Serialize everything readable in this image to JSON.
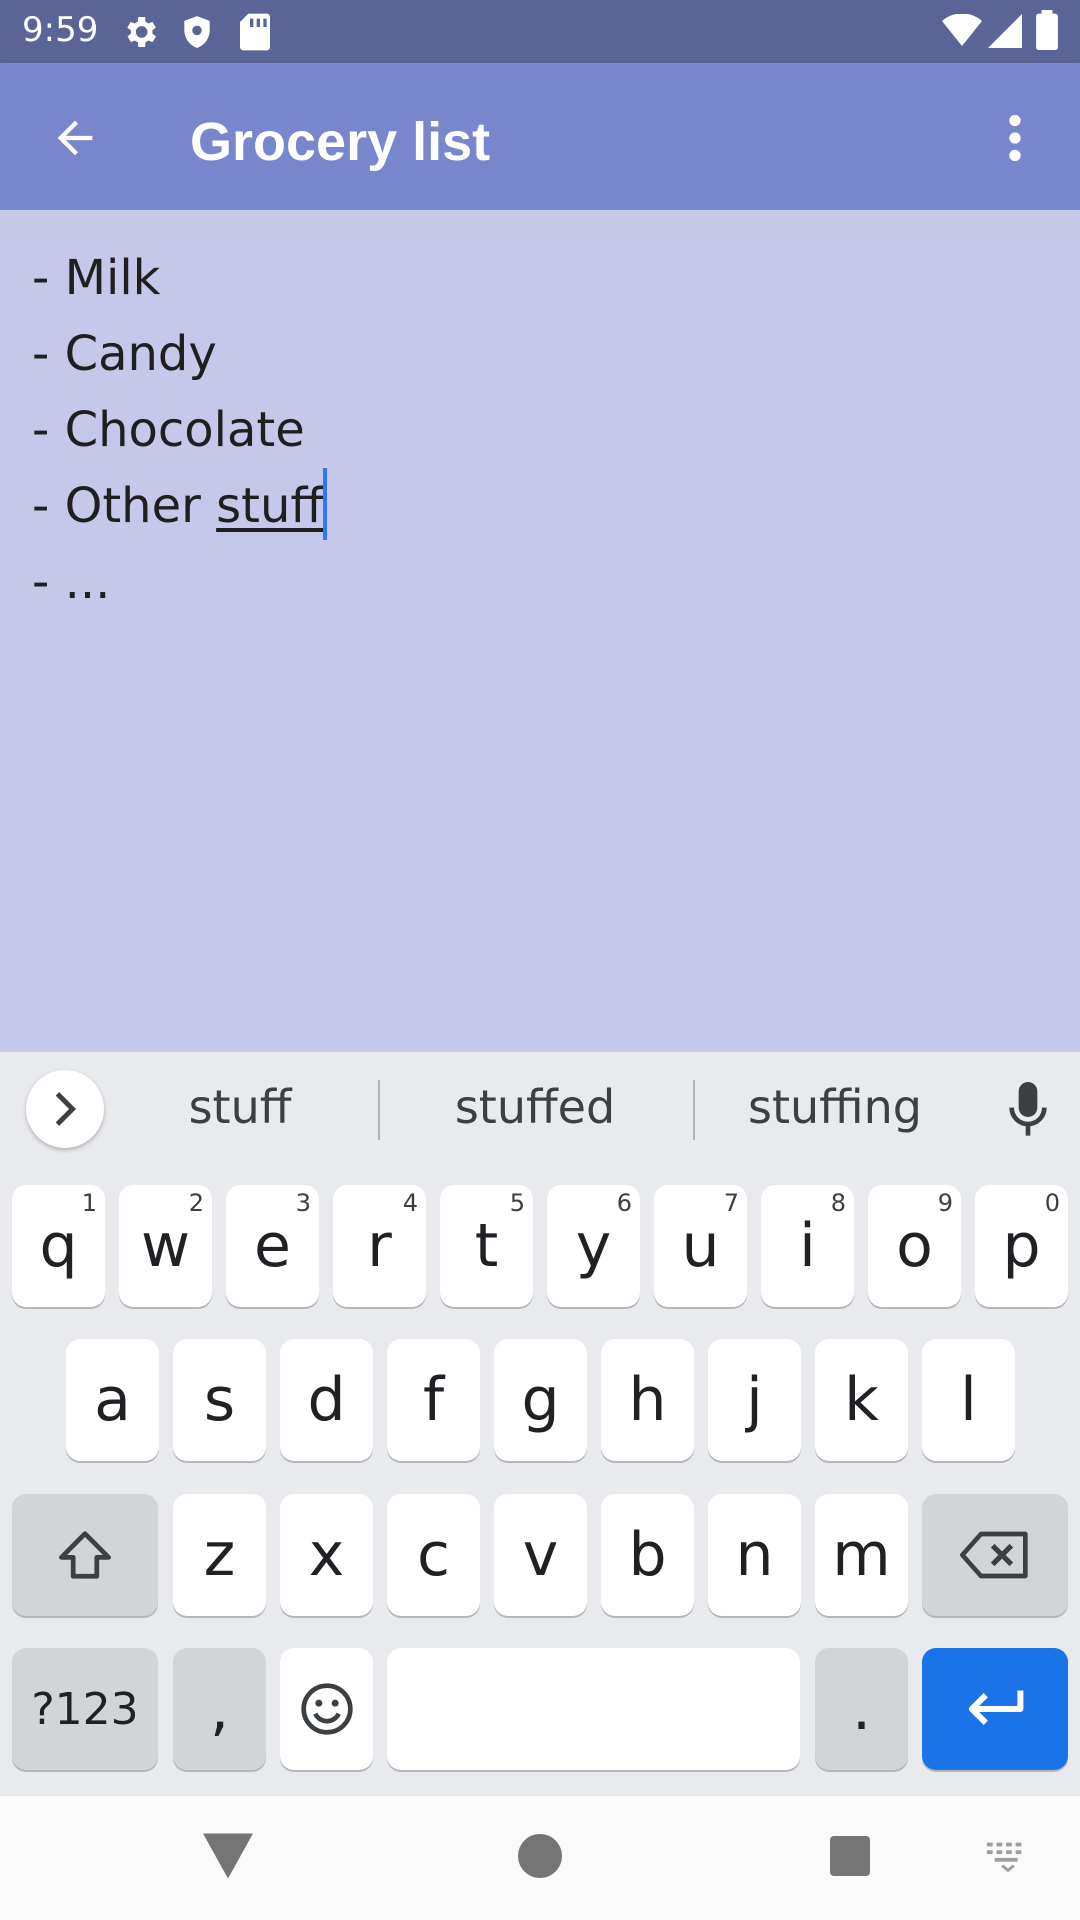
{
  "status_bar": {
    "time": "9:59",
    "icons_left": [
      "gear-icon",
      "shield-icon",
      "sd-card-icon"
    ],
    "icons_right": [
      "wifi-icon",
      "signal-icon",
      "battery-icon"
    ]
  },
  "app_bar": {
    "title": "Grocery list",
    "back_icon": "arrow-back-icon",
    "menu_icon": "more-vert-icon"
  },
  "note": {
    "lines": [
      "- Milk",
      "- Candy",
      "- Chocolate",
      "- Other ",
      "- ..."
    ],
    "composing_word": "stuff"
  },
  "keyboard": {
    "suggestions": [
      "stuff",
      "stuffed",
      "stuffing"
    ],
    "row1": [
      {
        "key": "q",
        "hint": "1"
      },
      {
        "key": "w",
        "hint": "2"
      },
      {
        "key": "e",
        "hint": "3"
      },
      {
        "key": "r",
        "hint": "4"
      },
      {
        "key": "t",
        "hint": "5"
      },
      {
        "key": "y",
        "hint": "6"
      },
      {
        "key": "u",
        "hint": "7"
      },
      {
        "key": "i",
        "hint": "8"
      },
      {
        "key": "o",
        "hint": "9"
      },
      {
        "key": "p",
        "hint": "0"
      }
    ],
    "row2": [
      "a",
      "s",
      "d",
      "f",
      "g",
      "h",
      "j",
      "k",
      "l"
    ],
    "row3": [
      "z",
      "x",
      "c",
      "v",
      "b",
      "n",
      "m"
    ],
    "symbols_label": "?123",
    "comma": ",",
    "period": ".",
    "accent_color": "#1a73e8"
  },
  "nav_bar": {
    "icons": [
      "back-triangle-icon",
      "home-circle-icon",
      "recents-square-icon",
      "keyboard-switch-icon"
    ]
  }
}
